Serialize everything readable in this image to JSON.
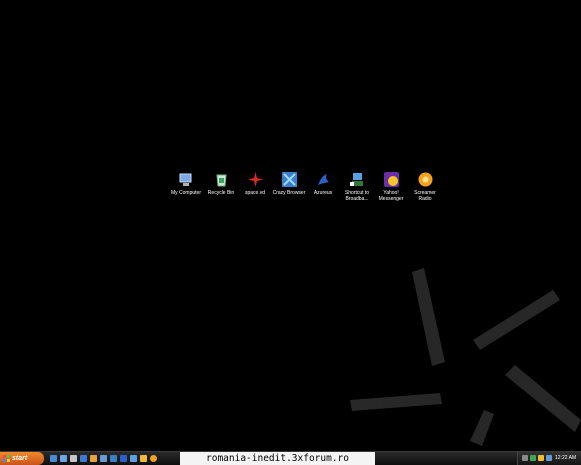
{
  "desktop": {
    "icons": [
      {
        "label": "My Computer",
        "icon": "my-computer-icon"
      },
      {
        "label": "Recycle Bin",
        "icon": "recycle-bin-icon"
      },
      {
        "label": "space.vd",
        "icon": "space-vd-icon"
      },
      {
        "label": "Crazy Browser",
        "icon": "crazy-browser-icon"
      },
      {
        "label": "Azureus",
        "icon": "azureus-icon"
      },
      {
        "label": "Shortcut to Broadba...",
        "icon": "broadband-shortcut-icon"
      },
      {
        "label": "Yahoo! Messenger",
        "icon": "yahoo-messenger-icon"
      },
      {
        "label": "Screamer Radio",
        "icon": "screamer-radio-icon"
      }
    ]
  },
  "taskbar": {
    "start_label": "start",
    "watermark": "romania-inedit.3xforum.ro",
    "clock": "12:22 AM"
  },
  "colors": {
    "start": "#e2702a",
    "desktop": "#000000",
    "taskbar": "#1a1a1a"
  }
}
